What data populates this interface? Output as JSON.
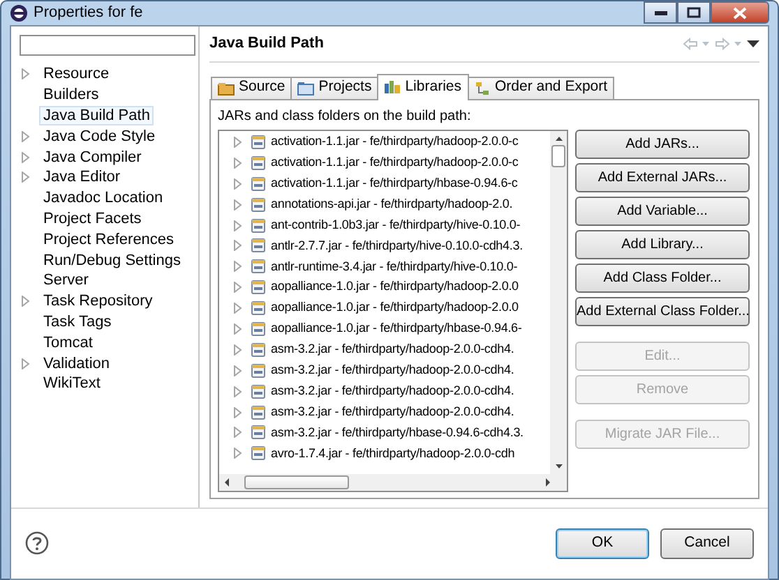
{
  "window": {
    "title": "Properties for fe"
  },
  "sidebar": {
    "items": [
      {
        "label": "Resource",
        "kind": "branch",
        "selected": false
      },
      {
        "label": "Builders",
        "kind": "leaf",
        "selected": false
      },
      {
        "label": "Java Build Path",
        "kind": "leaf",
        "selected": true
      },
      {
        "label": "Java Code Style",
        "kind": "branch",
        "selected": false
      },
      {
        "label": "Java Compiler",
        "kind": "branch",
        "selected": false
      },
      {
        "label": "Java Editor",
        "kind": "branch",
        "selected": false
      },
      {
        "label": "Javadoc Location",
        "kind": "leaf",
        "selected": false
      },
      {
        "label": "Project Facets",
        "kind": "leaf",
        "selected": false
      },
      {
        "label": "Project References",
        "kind": "leaf",
        "selected": false
      },
      {
        "label": "Run/Debug Settings",
        "kind": "leaf",
        "selected": false
      },
      {
        "label": "Server",
        "kind": "leaf",
        "selected": false
      },
      {
        "label": "Task Repository",
        "kind": "branch",
        "selected": false
      },
      {
        "label": "Task Tags",
        "kind": "leaf",
        "selected": false
      },
      {
        "label": "Tomcat",
        "kind": "leaf",
        "selected": false
      },
      {
        "label": "Validation",
        "kind": "branch",
        "selected": false
      },
      {
        "label": "WikiText",
        "kind": "leaf",
        "selected": false
      }
    ]
  },
  "page": {
    "title": "Java Build Path",
    "tabs": [
      {
        "label": "Source",
        "kind": "source",
        "selected": false
      },
      {
        "label": "Projects",
        "kind": "projects",
        "selected": false
      },
      {
        "label": "Libraries",
        "kind": "libraries",
        "selected": true
      },
      {
        "label": "Order and Export",
        "kind": "order",
        "selected": false
      }
    ],
    "list_label": "JARs and class folders on the build path:",
    "entries": [
      "activation-1.1.jar - fe/thirdparty/hadoop-2.0.0-c",
      "activation-1.1.jar - fe/thirdparty/hadoop-2.0.0-c",
      "activation-1.1.jar - fe/thirdparty/hbase-0.94.6-c",
      "annotations-api.jar - fe/thirdparty/hadoop-2.0.",
      "ant-contrib-1.0b3.jar - fe/thirdparty/hive-0.10.0-",
      "antlr-2.7.7.jar - fe/thirdparty/hive-0.10.0-cdh4.3.",
      "antlr-runtime-3.4.jar - fe/thirdparty/hive-0.10.0-",
      "aopalliance-1.0.jar - fe/thirdparty/hadoop-2.0.0",
      "aopalliance-1.0.jar - fe/thirdparty/hadoop-2.0.0",
      "aopalliance-1.0.jar - fe/thirdparty/hbase-0.94.6-",
      "asm-3.2.jar - fe/thirdparty/hadoop-2.0.0-cdh4.",
      "asm-3.2.jar - fe/thirdparty/hadoop-2.0.0-cdh4.",
      "asm-3.2.jar - fe/thirdparty/hadoop-2.0.0-cdh4.",
      "asm-3.2.jar - fe/thirdparty/hadoop-2.0.0-cdh4.",
      "asm-3.2.jar - fe/thirdparty/hbase-0.94.6-cdh4.3.",
      "avro-1.7.4.jar - fe/thirdparty/hadoop-2.0.0-cdh"
    ],
    "buttons": [
      {
        "label": "Add JARs...",
        "disabled": false,
        "gap_before": false
      },
      {
        "label": "Add External JARs...",
        "disabled": false,
        "gap_before": false
      },
      {
        "label": "Add Variable...",
        "disabled": false,
        "gap_before": false
      },
      {
        "label": "Add Library...",
        "disabled": false,
        "gap_before": false
      },
      {
        "label": "Add Class Folder...",
        "disabled": false,
        "gap_before": false
      },
      {
        "label": "Add External Class Folder...",
        "disabled": false,
        "gap_before": false
      },
      {
        "label": "Edit...",
        "disabled": true,
        "gap_before": true
      },
      {
        "label": "Remove",
        "disabled": true,
        "gap_before": false
      },
      {
        "label": "Migrate JAR File...",
        "disabled": true,
        "gap_before": true
      }
    ]
  },
  "footer": {
    "buttons": [
      {
        "label": "OK",
        "default": true
      },
      {
        "label": "Cancel",
        "default": false
      }
    ]
  }
}
